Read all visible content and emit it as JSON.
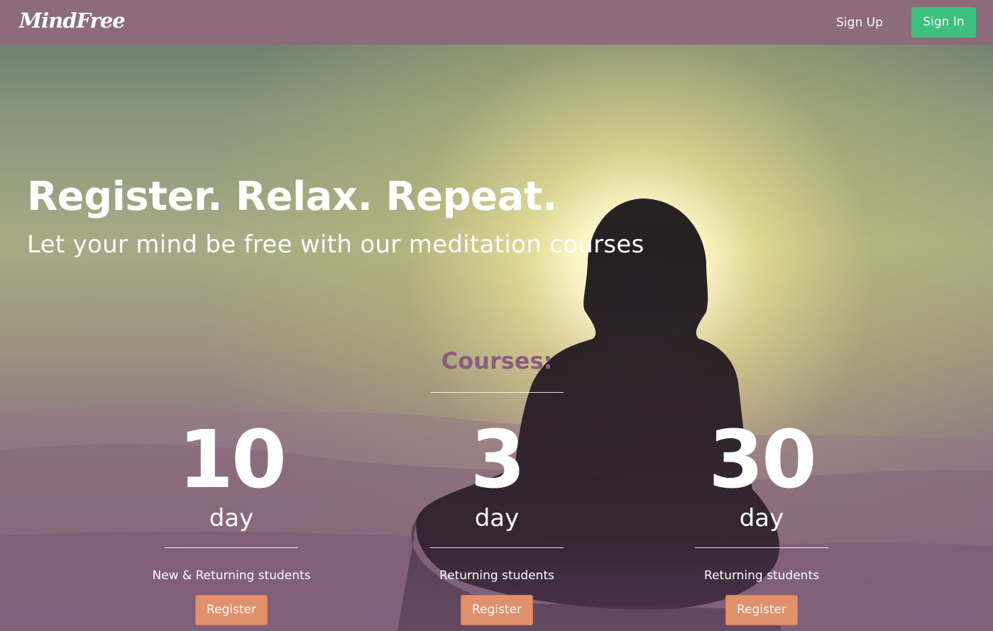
{
  "navbar": {
    "brand": "MindFree",
    "signup_label": "Sign Up",
    "signin_label": "Sign In"
  },
  "hero": {
    "headline": "Register. Relax. Repeat.",
    "subheadline": "Let your mind be free with our meditation courses"
  },
  "courses": {
    "title": "Courses:",
    "items": [
      {
        "number": "10",
        "unit": "day",
        "audience": "New & Returning students",
        "button_label": "Register"
      },
      {
        "number": "3",
        "unit": "day",
        "audience": "Returning students",
        "button_label": "Register"
      },
      {
        "number": "30",
        "unit": "day",
        "audience": "Returning students",
        "button_label": "Register"
      }
    ]
  },
  "colors": {
    "navbar": "#8d6b7c",
    "signin": "#3dbf7f",
    "register": "#e0906a",
    "courses_title": "#8a5d80"
  }
}
